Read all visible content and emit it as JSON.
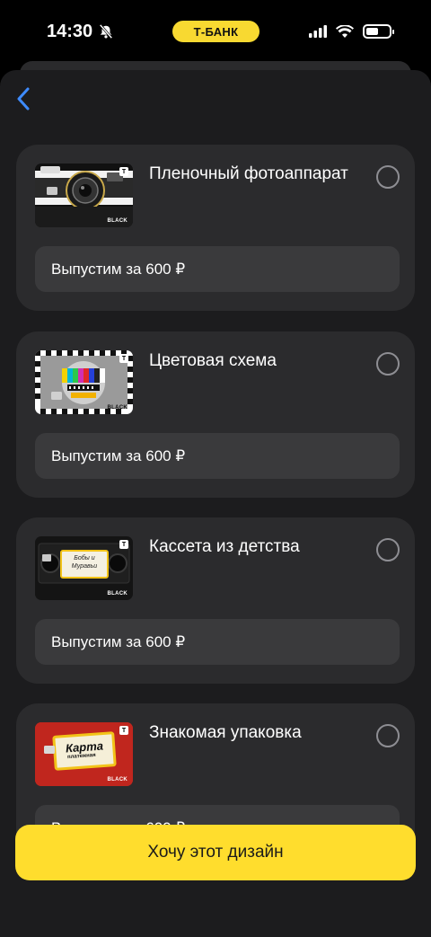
{
  "status_bar": {
    "time": "14:30",
    "bank_label": "Т-БАНК"
  },
  "cards": [
    {
      "title": "Пленочный фотоаппарат",
      "price_label": "Выпустим за 600 ₽",
      "thumb_icon": "film-camera-card-image",
      "brand_tag": "BLACK"
    },
    {
      "title": "Цветовая схема",
      "price_label": "Выпустим за 600 ₽",
      "thumb_icon": "test-pattern-card-image",
      "brand_tag": "BLACK"
    },
    {
      "title": "Кассета из детства",
      "price_label": "Выпустим за 600 ₽",
      "thumb_icon": "vhs-cassette-card-image",
      "brand_tag": "BLACK",
      "thumb_text": "Бобы и Муравьи"
    },
    {
      "title": "Знакомая упаковка",
      "price_label": "Выпустим за 600 ₽",
      "thumb_icon": "package-card-image",
      "brand_tag": "BLACK",
      "thumb_text": "Карта",
      "thumb_subtext": "платежная"
    }
  ],
  "cta": {
    "label": "Хочу этот дизайн"
  },
  "colors": {
    "accent": "#ffdd2d",
    "card_bg": "#2b2b2d",
    "back_arrow": "#3e8bff"
  }
}
